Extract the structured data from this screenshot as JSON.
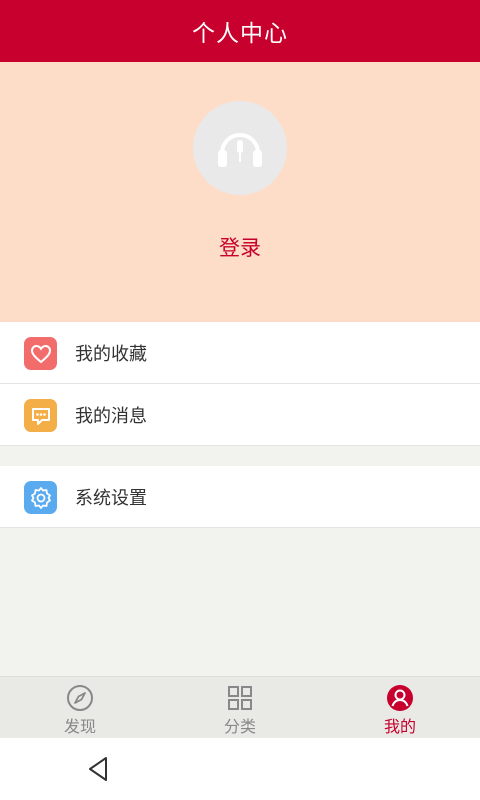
{
  "header": {
    "title": "个人中心"
  },
  "profile": {
    "login_label": "登录"
  },
  "menu": {
    "group1": [
      {
        "label": "我的收藏",
        "icon": "heart-icon",
        "color": "#f36c6c"
      },
      {
        "label": "我的消息",
        "icon": "message-icon",
        "color": "#f3ae48"
      }
    ],
    "group2": [
      {
        "label": "系统设置",
        "icon": "gear-icon",
        "color": "#5aaaf0"
      }
    ]
  },
  "bottom_nav": {
    "items": [
      {
        "label": "发现",
        "icon": "compass-icon",
        "active": false
      },
      {
        "label": "分类",
        "icon": "grid-icon",
        "active": false
      },
      {
        "label": "我的",
        "icon": "user-icon",
        "active": true
      }
    ]
  },
  "colors": {
    "brand": "#c8002d",
    "profile_bg": "#fddcc8",
    "inactive": "#888888"
  }
}
